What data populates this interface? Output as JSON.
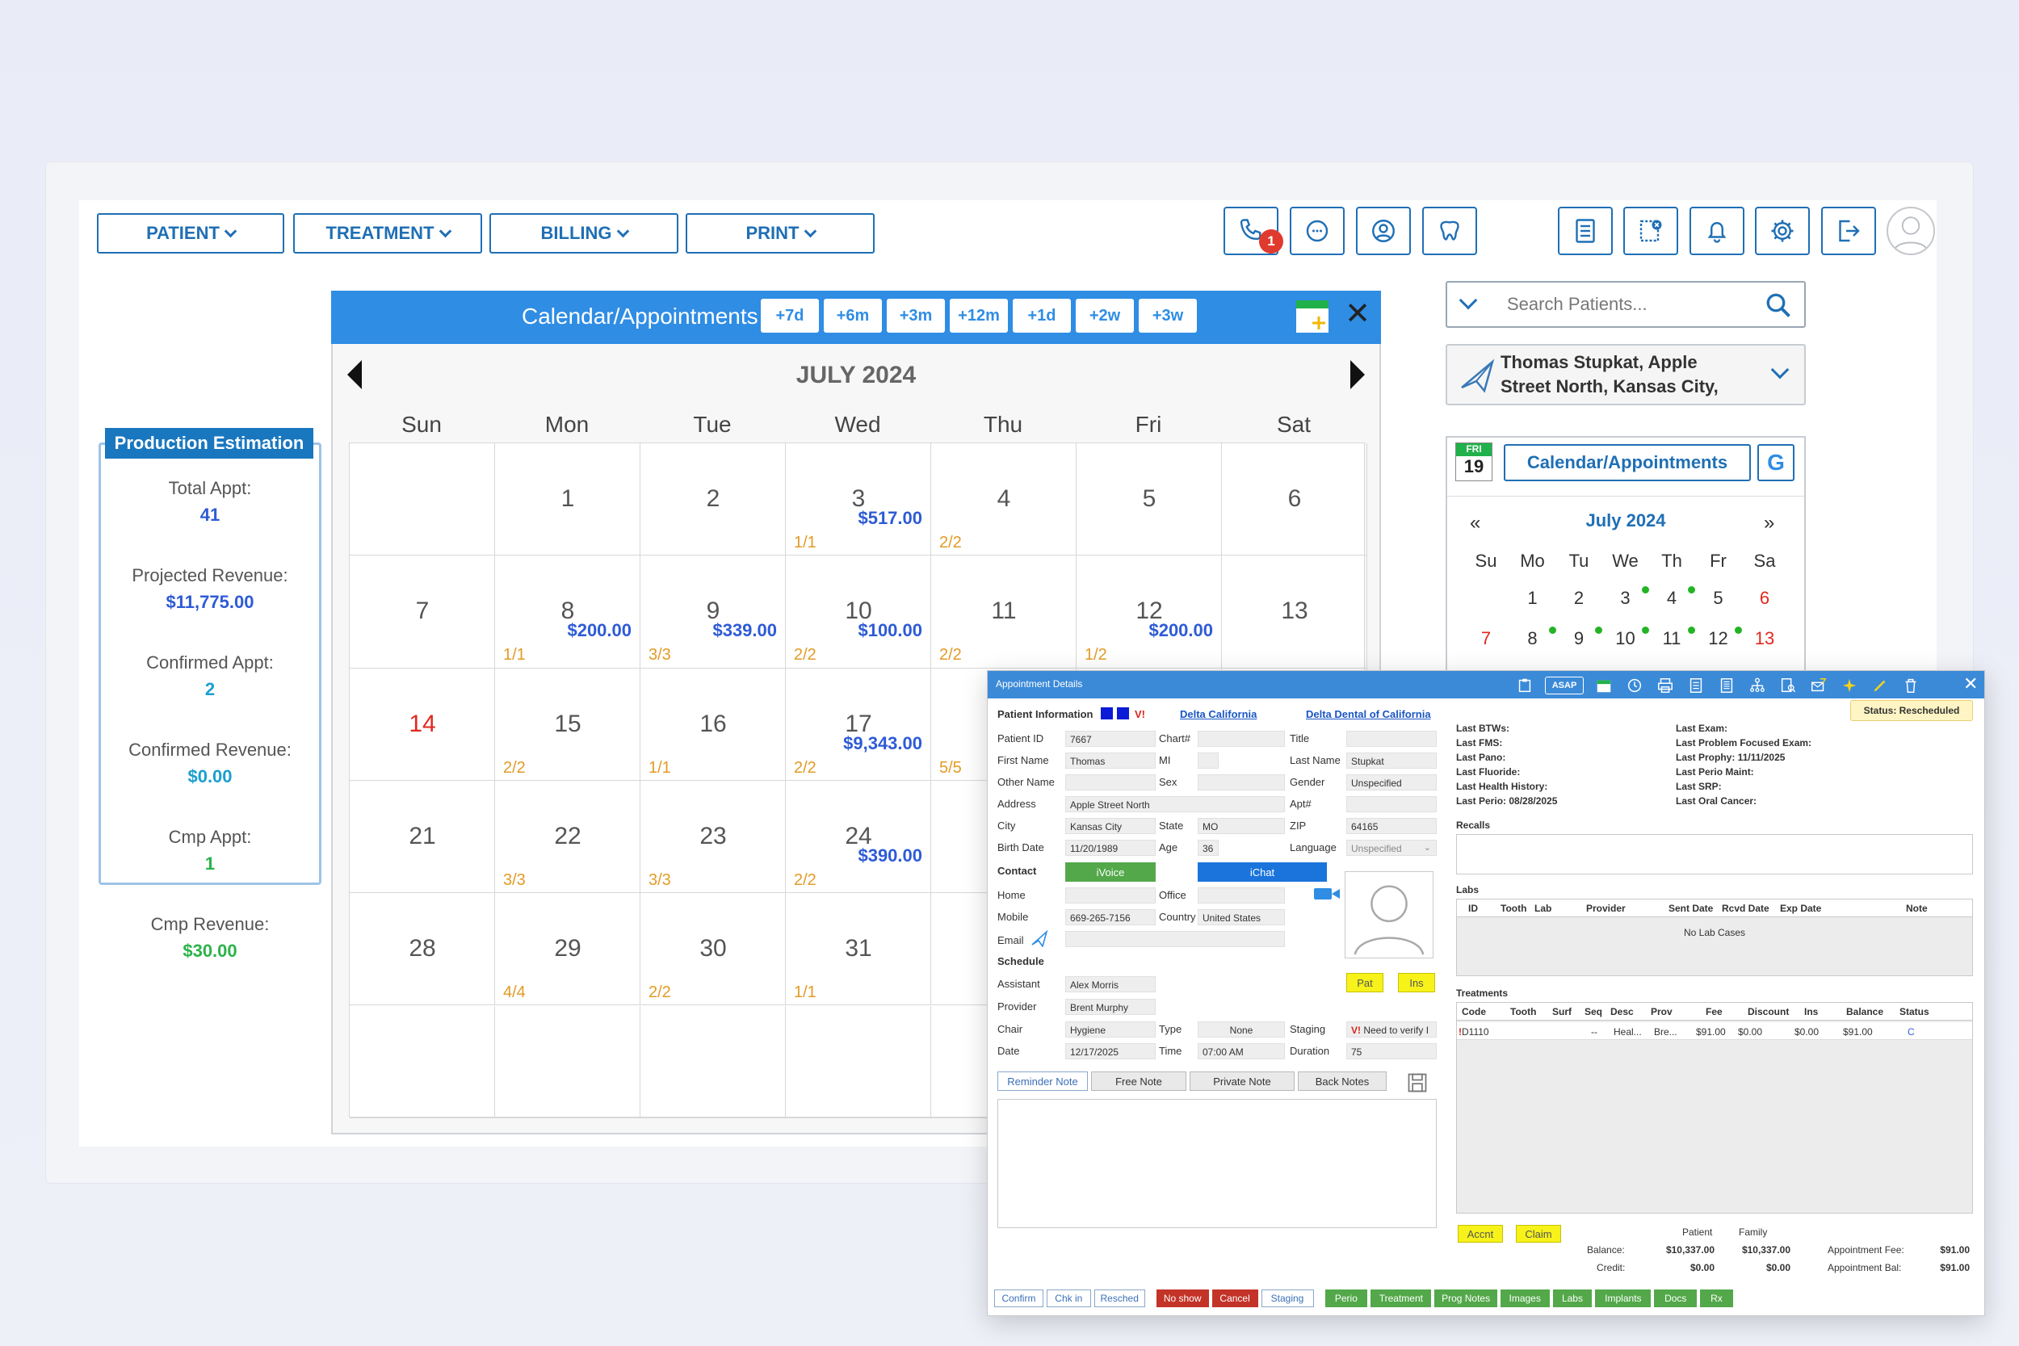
{
  "nav": {
    "menus": [
      "PATIENT",
      "TREATMENT",
      "BILLING",
      "PRINT"
    ],
    "phone_badge": "1"
  },
  "production": {
    "title": "Production Estimation",
    "rows": [
      {
        "label": "Total Appt:",
        "value": "41",
        "color": "#2e5bd6"
      },
      {
        "label": "Projected Revenue:",
        "value": "$11,775.00",
        "color": "#2e5bd6"
      },
      {
        "label": "Confirmed Appt:",
        "value": "2",
        "color": "#1a9fd0"
      },
      {
        "label": "Confirmed Revenue:",
        "value": "$0.00",
        "color": "#1a9fd0"
      },
      {
        "label": "Cmp Appt:",
        "value": "1",
        "color": "#2bb34a"
      },
      {
        "label": "Cmp Revenue:",
        "value": "$30.00",
        "color": "#2bb34a"
      }
    ]
  },
  "calendar": {
    "title": "Calendar/Appointments",
    "jump_buttons": [
      "+7d",
      "+6m",
      "+3m",
      "+12m",
      "+1d",
      "+2w",
      "+3w"
    ],
    "month": "JULY 2024",
    "days_of_week": [
      "Sun",
      "Mon",
      "Tue",
      "Wed",
      "Thu",
      "Fri",
      "Sat"
    ],
    "cells": [
      {
        "day": "",
        "amt": "",
        "frac": ""
      },
      {
        "day": "1",
        "amt": "",
        "frac": ""
      },
      {
        "day": "2",
        "amt": "",
        "frac": ""
      },
      {
        "day": "3",
        "amt": "$517.00",
        "frac": "1/1"
      },
      {
        "day": "4",
        "amt": "",
        "frac": "2/2"
      },
      {
        "day": "5",
        "amt": "",
        "frac": ""
      },
      {
        "day": "6",
        "amt": "",
        "frac": ""
      },
      {
        "day": "7",
        "amt": "",
        "frac": ""
      },
      {
        "day": "8",
        "amt": "$200.00",
        "frac": "1/1"
      },
      {
        "day": "9",
        "amt": "$339.00",
        "frac": "3/3"
      },
      {
        "day": "10",
        "amt": "$100.00",
        "frac": "2/2"
      },
      {
        "day": "11",
        "amt": "",
        "frac": "2/2"
      },
      {
        "day": "12",
        "amt": "$200.00",
        "frac": "1/2"
      },
      {
        "day": "13",
        "amt": "",
        "frac": ""
      },
      {
        "day": "14",
        "amt": "",
        "frac": "",
        "holiday": true
      },
      {
        "day": "15",
        "amt": "",
        "frac": "2/2"
      },
      {
        "day": "16",
        "amt": "",
        "frac": "1/1"
      },
      {
        "day": "17",
        "amt": "$9,343.00",
        "frac": "2/2"
      },
      {
        "day": "",
        "amt": "",
        "frac": "5/5"
      },
      {
        "day": "",
        "amt": "",
        "frac": ""
      },
      {
        "day": "",
        "amt": "",
        "frac": ""
      },
      {
        "day": "21",
        "amt": "",
        "frac": ""
      },
      {
        "day": "22",
        "amt": "",
        "frac": "3/3"
      },
      {
        "day": "23",
        "amt": "",
        "frac": "3/3"
      },
      {
        "day": "24",
        "amt": "$390.00",
        "frac": "2/2"
      },
      {
        "day": "",
        "amt": "",
        "frac": ""
      },
      {
        "day": "",
        "amt": "",
        "frac": ""
      },
      {
        "day": "",
        "amt": "",
        "frac": ""
      },
      {
        "day": "28",
        "amt": "",
        "frac": ""
      },
      {
        "day": "29",
        "amt": "",
        "frac": "4/4"
      },
      {
        "day": "30",
        "amt": "",
        "frac": "2/2"
      },
      {
        "day": "31",
        "amt": "",
        "frac": "1/1"
      },
      {
        "day": "",
        "amt": "",
        "frac": ""
      },
      {
        "day": "",
        "amt": "",
        "frac": ""
      },
      {
        "day": "",
        "amt": "",
        "frac": ""
      },
      {
        "day": "",
        "amt": "",
        "frac": ""
      },
      {
        "day": "",
        "amt": "",
        "frac": ""
      },
      {
        "day": "",
        "amt": "",
        "frac": ""
      },
      {
        "day": "",
        "amt": "",
        "frac": ""
      },
      {
        "day": "",
        "amt": "",
        "frac": ""
      },
      {
        "day": "",
        "amt": "",
        "frac": ""
      },
      {
        "day": "",
        "amt": "",
        "frac": ""
      }
    ]
  },
  "search": {
    "placeholder": "Search Patients..."
  },
  "patient_card": {
    "line1": "Thomas Stupkat, Apple",
    "line2": "Street North, Kansas City,"
  },
  "mini_cal": {
    "badge_day": "FRI",
    "badge_num": "19",
    "button": "Calendar/Appointments",
    "g_label": "G",
    "prev": "«",
    "next": "»",
    "month": "July 2024",
    "dow": [
      "Su",
      "Mo",
      "Tu",
      "We",
      "Th",
      "Fr",
      "Sa"
    ],
    "row1": [
      "",
      "1",
      "2",
      "3",
      "4",
      "5",
      "6"
    ],
    "row2": [
      "7",
      "8",
      "9",
      "10",
      "11",
      "12",
      "13"
    ]
  },
  "dialog": {
    "title": "Appointment Details",
    "asap": "ASAP",
    "status": "Status: Rescheduled",
    "patient_info": "Patient Information",
    "v_flag": "V!",
    "ins1": "Delta California",
    "ins2": "Delta Dental of California",
    "fields": {
      "patient_id_l": "Patient ID",
      "patient_id": "7667",
      "chart_l": "Chart#",
      "chart": "",
      "title_l": "Title",
      "title": "",
      "first_l": "First Name",
      "first": "Thomas",
      "mi_l": "MI",
      "mi": "",
      "last_l": "Last Name",
      "last": "Stupkat",
      "other_l": "Other Name",
      "other": "",
      "sex_l": "Sex",
      "sex": "",
      "gender_l": "Gender",
      "gender": "Unspecified",
      "address_l": "Address",
      "address": "Apple Street North",
      "apt_l": "Apt#",
      "apt": "",
      "city_l": "City",
      "city": "Kansas City",
      "state_l": "State",
      "state": "MO",
      "zip_l": "ZIP",
      "zip": "64165",
      "birth_l": "Birth Date",
      "birth": "11/20/1989",
      "age_l": "Age",
      "age": "36",
      "lang_l": "Language",
      "lang": "Unspecified",
      "contact_l": "Contact",
      "ivoice": "iVoice",
      "ichat": "iChat",
      "home_l": "Home",
      "home": "",
      "office_l": "Office",
      "office": "",
      "mobile_l": "Mobile",
      "mobile": "669-265-7156",
      "country_l": "Country",
      "country": "United States",
      "email_l": "Email",
      "email": "",
      "schedule_l": "Schedule",
      "assistant_l": "Assistant",
      "assistant": "Alex Morris",
      "provider_l": "Provider",
      "provider": "Brent Murphy",
      "chair_l": "Chair",
      "chair": "Hygiene",
      "type_l": "Type",
      "type": "None",
      "staging_l": "Staging",
      "staging": "Need to verify I",
      "date_l": "Date",
      "date": "12/17/2025",
      "time_l": "Time",
      "time": "07:00 AM",
      "duration_l": "Duration",
      "duration": "75",
      "pat_btn": "Pat",
      "ins_btn": "Ins"
    },
    "note_tabs": [
      "Reminder Note",
      "Free Note",
      "Private Note",
      "Back Notes"
    ],
    "last": {
      "btws": "Last BTWs:",
      "fms": "Last FMS:",
      "pano": "Last Pano:",
      "fluoride": "Last Fluoride:",
      "health": "Last Health History:",
      "perio": "Last Perio: 08/28/2025",
      "exam": "Last Exam:",
      "problem": "Last Problem Focused Exam:",
      "prophy": "Last Prophy: 11/11/2025",
      "perio_maint": "Last Perio Maint:",
      "srp": "Last SRP:",
      "oral": "Last Oral Cancer:"
    },
    "recalls": "Recalls",
    "labs": "Labs",
    "labs_cols": [
      "ID",
      "Tooth",
      "Lab",
      "Provider",
      "Sent Date",
      "Rcvd Date",
      "Exp Date",
      "Note"
    ],
    "labs_empty": "No Lab Cases",
    "treatments": "Treatments",
    "treat_cols": [
      "Code",
      "Tooth",
      "Surf",
      "Seq",
      "Desc",
      "Prov",
      "Fee",
      "Discount",
      "Ins",
      "Balance",
      "Status"
    ],
    "treat_row": [
      "D1110",
      "",
      "",
      "--",
      "Heal...",
      "Bre...",
      "$91.00",
      "$0.00",
      "$0.00",
      "$91.00",
      "C"
    ],
    "accnt": "Accnt",
    "claim": "Claim",
    "totals": {
      "patient_h": "Patient",
      "family_h": "Family",
      "balance_l": "Balance:",
      "balance_p": "$10,337.00",
      "balance_f": "$10,337.00",
      "credit_l": "Credit:",
      "credit_p": "$0.00",
      "credit_f": "$0.00",
      "fee_l": "Appointment Fee:",
      "fee": "$91.00",
      "bal_l": "Appointment Bal:",
      "bal": "$91.00"
    },
    "actions": [
      "Confirm",
      "Chk in",
      "Resched",
      "No show",
      "Cancel",
      "Staging",
      "Perio",
      "Treatment",
      "Prog Notes",
      "Images",
      "Labs",
      "Implants",
      "Docs",
      "Rx"
    ]
  }
}
